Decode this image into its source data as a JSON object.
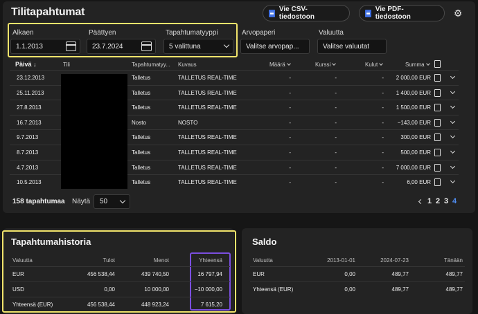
{
  "page": {
    "title": "Tilitapahtumat"
  },
  "export": {
    "csv_label": "Vie CSV-tiedostoon",
    "pdf_label": "Vie PDF-tiedostoon"
  },
  "filters": {
    "start_label": "Alkaen",
    "start_value": "1.1.2013",
    "end_label": "Päättyen",
    "end_value": "23.7.2024",
    "type_label": "Tapahtumatyyppi",
    "type_value": "5 valittuna",
    "security_label": "Arvopaperi",
    "security_placeholder": "Valitse arvopap...",
    "currency_label": "Valuutta",
    "currency_placeholder": "Valitse valuutat"
  },
  "table": {
    "headers": {
      "date": "Päivä",
      "account": "Tili",
      "type": "Tapahtumatyy...",
      "description": "Kuvaus",
      "quantity": "Määrä",
      "price": "Kurssi",
      "fees": "Kulut",
      "amount": "Summa"
    },
    "rows": [
      {
        "date": "23.12.2013",
        "type": "Talletus",
        "description": "TALLETUS REAL-TIME",
        "quantity": "-",
        "price": "-",
        "fees": "-",
        "amount": "2 000,00 EUR"
      },
      {
        "date": "25.11.2013",
        "type": "Talletus",
        "description": "TALLETUS REAL-TIME",
        "quantity": "-",
        "price": "-",
        "fees": "-",
        "amount": "1 400,00 EUR"
      },
      {
        "date": "27.8.2013",
        "type": "Talletus",
        "description": "TALLETUS REAL-TIME",
        "quantity": "-",
        "price": "-",
        "fees": "-",
        "amount": "1 500,00 EUR"
      },
      {
        "date": "16.7.2013",
        "type": "Nosto",
        "description": "NOSTO",
        "quantity": "-",
        "price": "-",
        "fees": "-",
        "amount": "−143,00 EUR"
      },
      {
        "date": "9.7.2013",
        "type": "Talletus",
        "description": "TALLETUS REAL-TIME",
        "quantity": "-",
        "price": "-",
        "fees": "-",
        "amount": "300,00 EUR"
      },
      {
        "date": "8.7.2013",
        "type": "Talletus",
        "description": "TALLETUS REAL-TIME",
        "quantity": "-",
        "price": "-",
        "fees": "-",
        "amount": "500,00 EUR"
      },
      {
        "date": "4.7.2013",
        "type": "Talletus",
        "description": "TALLETUS REAL-TIME",
        "quantity": "-",
        "price": "-",
        "fees": "-",
        "amount": "7 000,00 EUR"
      },
      {
        "date": "10.5.2013",
        "type": "Talletus",
        "description": "TALLETUS REAL-TIME",
        "quantity": "-",
        "price": "-",
        "fees": "-",
        "amount": "6,00 EUR"
      }
    ]
  },
  "footer": {
    "count": "158 tapahtumaa",
    "show_label": "Näytä",
    "page_size": "50",
    "pages": [
      "1",
      "2",
      "3",
      "4"
    ],
    "current_page": "4"
  },
  "history": {
    "title": "Tapahtumahistoria",
    "headers": {
      "currency": "Valuutta",
      "income": "Tulot",
      "expenses": "Menot",
      "total": "Yhteensä"
    },
    "rows": [
      {
        "currency": "EUR",
        "income": "456 538,44",
        "expenses": "439 740,50",
        "total": "16 797,94"
      },
      {
        "currency": "USD",
        "income": "0,00",
        "expenses": "10 000,00",
        "total": "−10 000,00"
      },
      {
        "currency": "Yhteensä (EUR)",
        "income": "456 538,44",
        "expenses": "448 923,24",
        "total": "7 615,20"
      }
    ]
  },
  "balance": {
    "title": "Saldo",
    "headers": {
      "currency": "Valuutta",
      "d1": "2013-01-01",
      "d2": "2024-07-23",
      "today": "Tänään"
    },
    "rows": [
      {
        "currency": "EUR",
        "d1": "0,00",
        "d2": "489,77",
        "today": "489,77"
      },
      {
        "currency": "Yhteensä (EUR)",
        "d1": "0,00",
        "d2": "489,77",
        "today": "489,77"
      }
    ]
  },
  "colors": {
    "background": "#161616",
    "panel": "#232323",
    "highlight_yellow": "#f1e46b",
    "highlight_purple": "#7b4fe0",
    "active_page": "#4f8cf0"
  }
}
